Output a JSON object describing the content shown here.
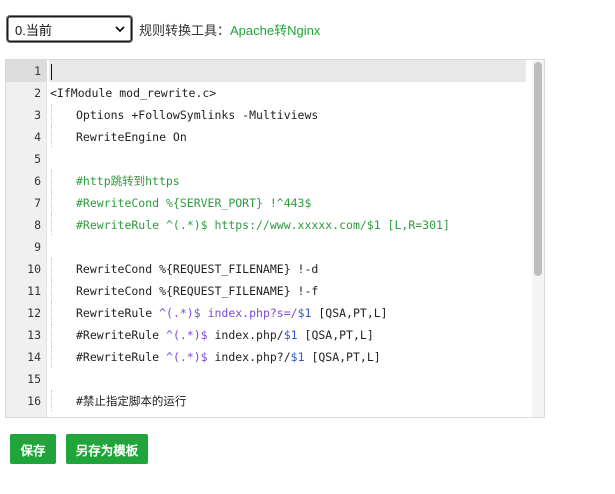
{
  "toolbar": {
    "select_value": "0.当前",
    "label": "规则转换工具：",
    "link_text": "Apache转Nginx"
  },
  "editor": {
    "lines": [
      {
        "n": "1",
        "indent": 0,
        "segments": []
      },
      {
        "n": "2",
        "indent": 0,
        "segments": [
          {
            "t": "<IfModule mod_rewrite.c>",
            "c": "plain"
          }
        ]
      },
      {
        "n": "3",
        "indent": 1,
        "segments": [
          {
            "t": "Options +FollowSymlinks -Multiviews",
            "c": "plain"
          }
        ]
      },
      {
        "n": "4",
        "indent": 1,
        "segments": [
          {
            "t": "RewriteEngine On",
            "c": "plain"
          }
        ]
      },
      {
        "n": "5",
        "indent": 0,
        "segments": []
      },
      {
        "n": "6",
        "indent": 1,
        "segments": [
          {
            "t": "#http跳转到https",
            "c": "comment"
          }
        ]
      },
      {
        "n": "7",
        "indent": 1,
        "segments": [
          {
            "t": "#RewriteCond %{SERVER_PORT} !^443$",
            "c": "comment"
          }
        ]
      },
      {
        "n": "8",
        "indent": 1,
        "segments": [
          {
            "t": "#RewriteRule ^(.*)$ https://www.xxxxx.com/$1 [L,R=301]",
            "c": "comment"
          }
        ]
      },
      {
        "n": "9",
        "indent": 0,
        "segments": []
      },
      {
        "n": "10",
        "indent": 1,
        "segments": [
          {
            "t": "RewriteCond %{REQUEST_FILENAME} !-d",
            "c": "plain"
          }
        ]
      },
      {
        "n": "11",
        "indent": 1,
        "segments": [
          {
            "t": "RewriteCond %{REQUEST_FILENAME} !-f",
            "c": "plain"
          }
        ]
      },
      {
        "n": "12",
        "indent": 1,
        "segments": [
          {
            "t": "RewriteRule ",
            "c": "plain"
          },
          {
            "t": "^(.*)$ ",
            "c": "regex"
          },
          {
            "t": "index.php?s=/",
            "c": "regex"
          },
          {
            "t": "$1",
            "c": "var"
          },
          {
            "t": " [QSA,PT,L]",
            "c": "plain"
          }
        ]
      },
      {
        "n": "13",
        "indent": 1,
        "segments": [
          {
            "t": "#RewriteRule ",
            "c": "plain"
          },
          {
            "t": "^(.*)$ ",
            "c": "regex"
          },
          {
            "t": "index.php/",
            "c": "plain"
          },
          {
            "t": "$1",
            "c": "var"
          },
          {
            "t": " [QSA,PT,L]",
            "c": "plain"
          }
        ]
      },
      {
        "n": "14",
        "indent": 1,
        "segments": [
          {
            "t": "#RewriteRule ",
            "c": "plain"
          },
          {
            "t": "^(.*)$ ",
            "c": "regex"
          },
          {
            "t": "index.php?/",
            "c": "plain"
          },
          {
            "t": "$1",
            "c": "var"
          },
          {
            "t": " [QSA,PT,L]",
            "c": "plain"
          }
        ]
      },
      {
        "n": "15",
        "indent": 0,
        "segments": []
      },
      {
        "n": "16",
        "indent": 1,
        "segments": [
          {
            "t": "#禁止指定脚本的运行",
            "c": "plain"
          }
        ]
      }
    ]
  },
  "buttons": {
    "save": "保存",
    "save_as_template": "另存为模板"
  },
  "colors": {
    "accent": "#20a53a",
    "comment": "#2c9c3e",
    "regex": "#7a4ad6",
    "variable": "#3055c9"
  }
}
